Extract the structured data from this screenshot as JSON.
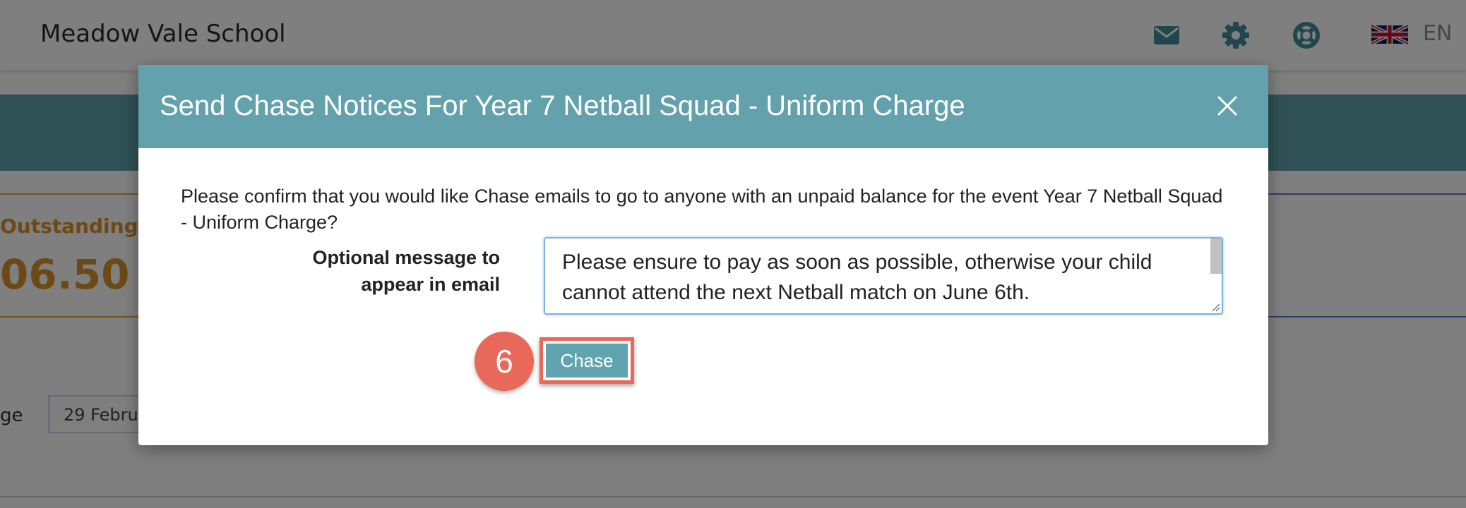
{
  "app": {
    "school_name": "Meadow Vale School",
    "language": "EN"
  },
  "icons": {
    "mail": "mail-icon",
    "settings": "gear-icon",
    "help": "lifebuoy-icon",
    "flag": "uk-flag-icon",
    "close": "close-icon"
  },
  "background": {
    "outstanding_label": "Outstanding",
    "outstanding_value": "06.50",
    "range_label": "ge",
    "date_value": "29 Februa"
  },
  "modal": {
    "title": "Send Chase Notices For Year 7 Netball Squad - Uniform Charge",
    "confirm_text": "Please confirm that you would like Chase emails to go to anyone with an unpaid balance for the event Year 7 Netball Squad - Uniform Charge?",
    "optional_label": "Optional message to appear in email",
    "message_value": "Please ensure to pay as soon as possible, otherwise your child cannot attend the next Netball match on June 6th. ",
    "chase_label": "Chase",
    "step_number": "6"
  },
  "colors": {
    "header_teal": "#63a2ad",
    "button_teal": "#61a3ae",
    "highlight_red": "#e8685a",
    "outstanding_orange": "#d9922e"
  }
}
